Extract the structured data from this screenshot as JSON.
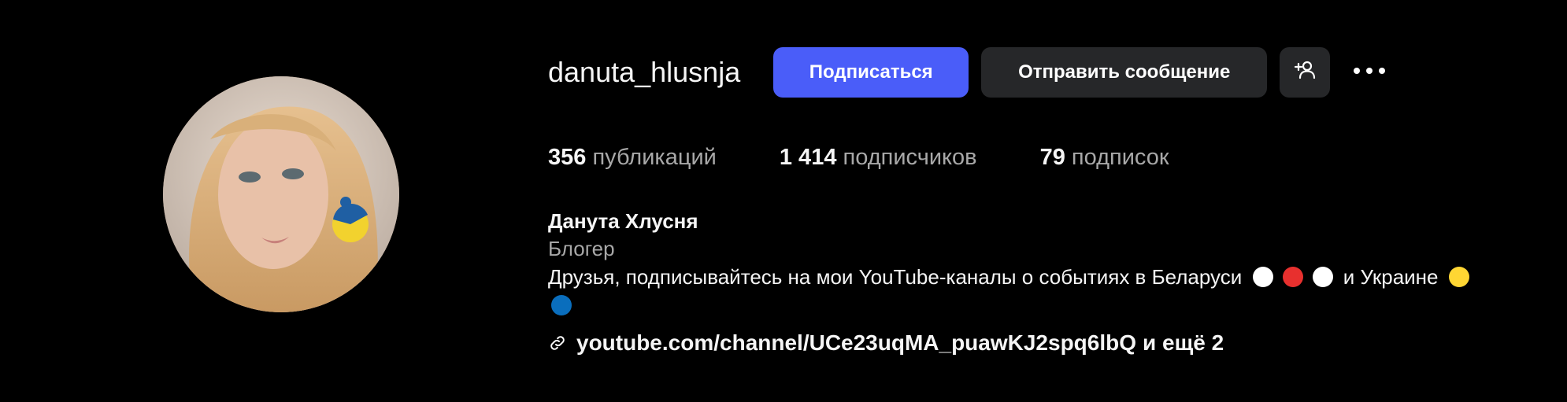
{
  "profile": {
    "username": "danuta_hlusnja",
    "follow_label": "Подписаться",
    "message_label": "Отправить сообщение",
    "suggest_icon": "person-add-icon",
    "more_icon": "more-horizontal-icon",
    "avatar_icon": "profile-photo"
  },
  "stats": {
    "posts_count": "356",
    "posts_label": "публикаций",
    "followers_count": "1 414",
    "followers_label": "подписчиков",
    "following_count": "79",
    "following_label": "подписок"
  },
  "bio": {
    "full_name": "Данута Хлусня",
    "category": "Блогер",
    "text_part1": "Друзья, подписывайтесь на мои YouTube-каналы о событиях в Беларуси",
    "text_part2": "и Украине",
    "belarus_dots": [
      "#ffffff",
      "#e8302e",
      "#ffffff"
    ],
    "ukraine_dots": [
      "#ffd633",
      "#0a6ebd"
    ],
    "link_icon": "link-icon",
    "link_text": "youtube.com/channel/UCe23uqMA_puawKJ2spq6lbQ",
    "more_links": "и ещё 2"
  },
  "colors": {
    "background": "#000000",
    "follow_button": "#4a5df9",
    "secondary_button": "#262729",
    "muted_text": "#a8a8a8"
  }
}
